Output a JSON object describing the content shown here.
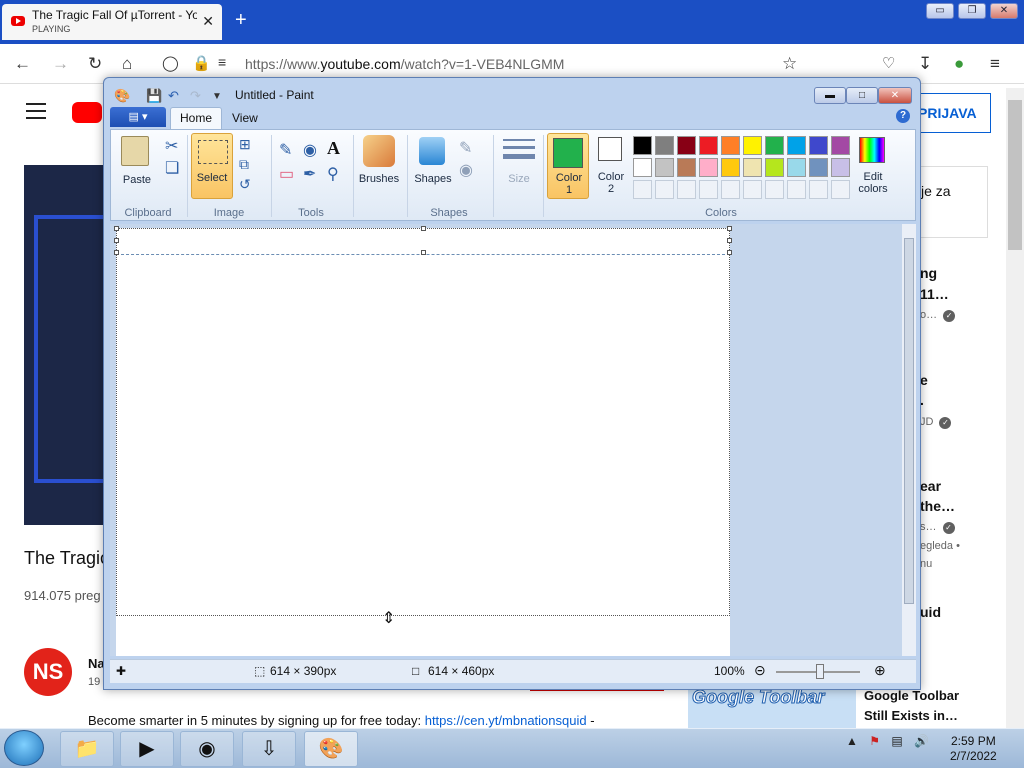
{
  "browser": {
    "tab_title": "The Tragic Fall Of µTorrent - YouTube",
    "tab_status": "PLAYING",
    "tab_close": "✕",
    "new_tab": "+",
    "url_prefix": "https://www.",
    "url_domain": "youtube.com",
    "url_path": "/watch?v=1-VEB4NLGMM",
    "win_min": "▭",
    "win_restore": "❐",
    "win_close": "✕"
  },
  "youtube": {
    "sign_in": "PRIJAVA",
    "promo_text": "je za",
    "title": "The Tragic",
    "views": "914.075 preg",
    "channel_initials": "NS",
    "channel_name": "Na",
    "channel_sub": "19",
    "description": "Become smarter in 5 minutes by signing up for free today: ",
    "description_link": "https://cen.yt/mbnationsquid",
    "description_tail": " -",
    "sidebar": [
      {
        "line1": "ng",
        "line2": "11…",
        "meta": "o…"
      },
      {
        "line1": "e",
        "line2": ".",
        "meta": "JD"
      },
      {
        "line1": "ear",
        "line2": "the…",
        "meta": "s…",
        "meta2": "egleda •",
        "meta3": "nu"
      },
      {
        "line1": "uid"
      }
    ],
    "promo_thumb_text": "Google Toolbar",
    "promo_title_1": "Google Toolbar",
    "promo_title_2": "Still Exists in…"
  },
  "paint": {
    "title": "Untitled - Paint",
    "tabs": {
      "home": "Home",
      "view": "View"
    },
    "help": "?",
    "groups": {
      "clipboard": "Clipboard",
      "image": "Image",
      "tools": "Tools",
      "shapes": "Shapes",
      "colors": "Colors"
    },
    "buttons": {
      "paste": "Paste",
      "select": "Select",
      "brushes": "Brushes",
      "shapes": "Shapes",
      "size": "Size",
      "color1": "Color\n1",
      "color2": "Color\n2",
      "edit_colors": "Edit\ncolors"
    },
    "color1_value": "#22b14c",
    "color2_value": "#ffffff",
    "palette_row1": [
      "#000000",
      "#7f7f7f",
      "#880015",
      "#ed1c24",
      "#ff7f27",
      "#fff200",
      "#22b14c",
      "#00a2e8",
      "#3f48cc",
      "#a349a4"
    ],
    "palette_row2": [
      "#ffffff",
      "#c3c3c3",
      "#b97a57",
      "#ffaec9",
      "#ffc90e",
      "#efe4b0",
      "#b5e61d",
      "#99d9ea",
      "#7092be",
      "#c8bfe7"
    ],
    "status": {
      "selection": "614 × 390px",
      "size": "614 × 460px",
      "zoom": "100%"
    }
  },
  "taskbar": {
    "time": "2:59 PM",
    "date": "2/7/2022"
  }
}
